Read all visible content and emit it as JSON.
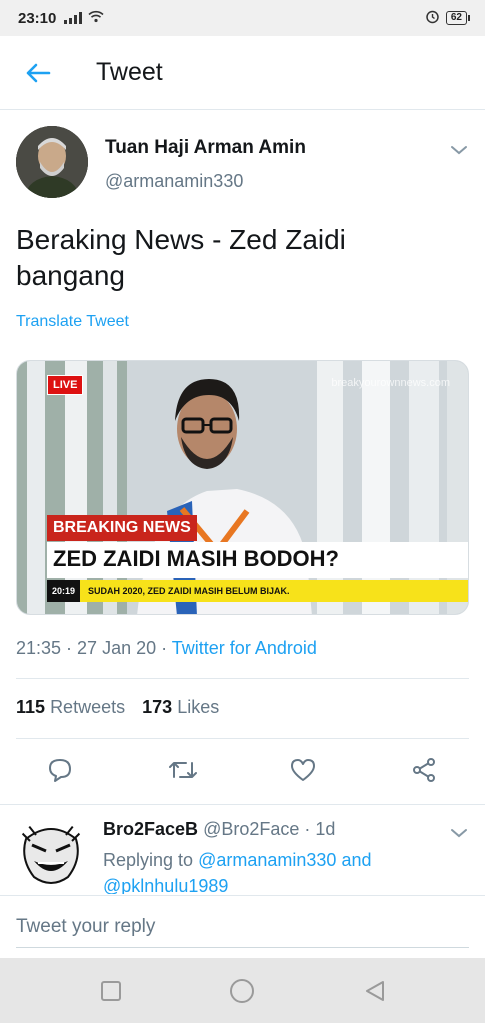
{
  "status_bar": {
    "time": "23:10",
    "battery": "62"
  },
  "header": {
    "title": "Tweet"
  },
  "tweet": {
    "author_name": "Tuan Haji Arman Amin",
    "author_handle": "@armanamin330",
    "text": "Beraking News - Zed Zaidi bangang",
    "translate_label": "Translate Tweet",
    "image": {
      "live_label": "LIVE",
      "watermark": "breakyourownnews.com",
      "breaking_label": "BREAKING NEWS",
      "headline": "ZED ZAIDI MASIH BODOH?",
      "ticker_time": "20:19",
      "ticker_text": "SUDAH 2020, ZED ZAIDI MASIH BELUM BIJAK."
    },
    "time": "21:35",
    "date": "27 Jan 20",
    "source": "Twitter for Android",
    "retweets_count": "115",
    "retweets_label": "Retweets",
    "likes_count": "173",
    "likes_label": "Likes"
  },
  "reply": {
    "name": "Bro2FaceB",
    "handle": "@Bro2Face",
    "age": "1d",
    "replying_to_label": "Replying to",
    "mention_1": "@armanamin330",
    "and_label": "and",
    "mention_2": "@pklnhulu1989"
  },
  "compose": {
    "placeholder": "Tweet your reply"
  },
  "colors": {
    "accent": "#1da1f2",
    "text": "#14171a",
    "muted": "#657786",
    "border": "#e1e8ed"
  }
}
